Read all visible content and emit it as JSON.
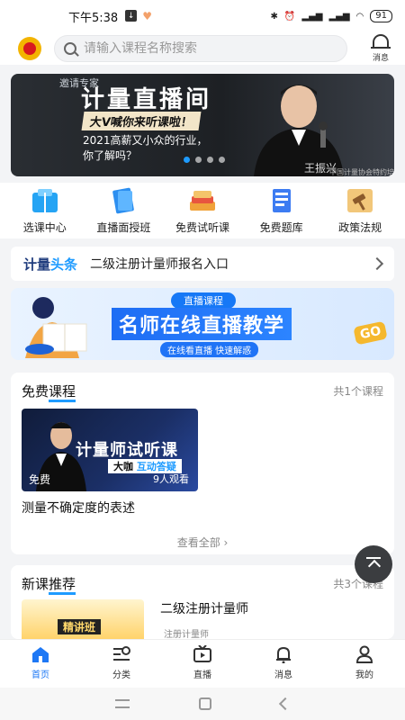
{
  "status": {
    "time": "下午5:38",
    "battery": "91"
  },
  "header": {
    "search_placeholder": "请输入课程名称搜索",
    "message_label": "消息"
  },
  "banner": {
    "top_text": "邀请专家",
    "title": "计量直播间",
    "subtitle": "大V喊你来听课啦！",
    "desc_line1": "2021高薪又小众的行业，",
    "desc_line2": "你了解吗？",
    "name": "王振兴",
    "caption": "中国计量协会特约培训讲师"
  },
  "categories": [
    {
      "label": "选课中心",
      "icon": "book-icon",
      "color": "#25a4f4"
    },
    {
      "label": "直播面授班",
      "icon": "books-icon",
      "color": "#2d8ff0"
    },
    {
      "label": "免费试听课",
      "icon": "open-book-icon",
      "color": "#f0a23a"
    },
    {
      "label": "免费题库",
      "icon": "exam-icon",
      "color": "#3d7cf2"
    },
    {
      "label": "政策法规",
      "icon": "gavel-icon",
      "color": "#e0962b"
    }
  ],
  "news": {
    "title_a": "计量",
    "title_b": "头条",
    "text": "二级注册计量师报名入口"
  },
  "promo": {
    "tag": "直播课程",
    "title": "名师在线直播教学",
    "sub": "在线看直播 快速解惑",
    "corner": "GO"
  },
  "free_courses": {
    "title_a": "免费",
    "title_b": "课程",
    "count": "共1个课程",
    "image_title": "计量师试听课",
    "badge_a": "大咖",
    "badge_b": "互动答疑",
    "free_label": "免费",
    "views": "9人观看",
    "course_name": "测量不确定度的表述",
    "view_all": "查看全部 ›"
  },
  "new_courses": {
    "title_a": "新课",
    "title_b": "推荐",
    "count": "共3个课程",
    "thumb_label": "精讲班",
    "course_name": "二级注册计量师",
    "course_sub": "注册计量师"
  },
  "tabbar": [
    {
      "label": "首页",
      "icon": "home-icon"
    },
    {
      "label": "分类",
      "icon": "category-search-icon"
    },
    {
      "label": "直播",
      "icon": "tv-icon"
    },
    {
      "label": "消息",
      "icon": "bell-icon"
    },
    {
      "label": "我的",
      "icon": "user-icon"
    }
  ],
  "colors": {
    "accent": "#1e78f5",
    "accent_light": "#1e9bff",
    "bg": "#f3f4f6"
  }
}
